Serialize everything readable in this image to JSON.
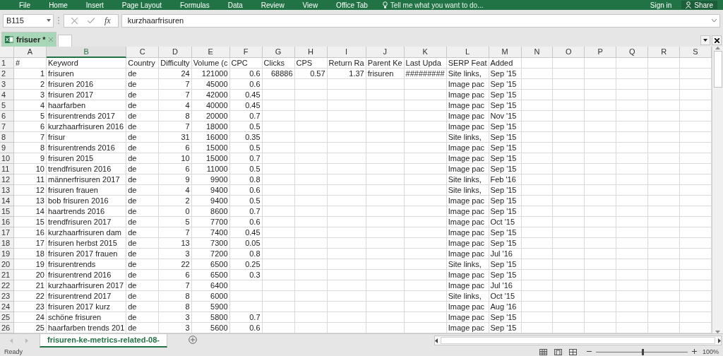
{
  "ribbon": {
    "tabs": [
      "File",
      "Home",
      "Insert",
      "Page Layout",
      "Formulas",
      "Data",
      "Review",
      "View",
      "Office Tab"
    ],
    "tell_me": "Tell me what you want to do...",
    "sign_in": "Sign in",
    "share": "Share"
  },
  "formula_bar": {
    "name_box": "B115",
    "function_label": "fx",
    "value": "kurzhaarfrisuren"
  },
  "document_tabs": [
    {
      "label": "frisuer *",
      "selected": true
    }
  ],
  "sheet": {
    "columns": [
      {
        "label": "A",
        "selected": false
      },
      {
        "label": "B",
        "selected": true
      },
      {
        "label": "C",
        "selected": false
      },
      {
        "label": "D",
        "selected": false
      },
      {
        "label": "E",
        "selected": false
      },
      {
        "label": "F",
        "selected": false
      },
      {
        "label": "G",
        "selected": false
      },
      {
        "label": "H",
        "selected": false
      },
      {
        "label": "I",
        "selected": false
      },
      {
        "label": "J",
        "selected": false
      },
      {
        "label": "K",
        "selected": false
      },
      {
        "label": "L",
        "selected": false
      },
      {
        "label": "M",
        "selected": false
      },
      {
        "label": "N",
        "selected": false
      },
      {
        "label": "O",
        "selected": false
      },
      {
        "label": "P",
        "selected": false
      },
      {
        "label": "Q",
        "selected": false
      },
      {
        "label": "R",
        "selected": false
      },
      {
        "label": "S",
        "selected": false
      }
    ],
    "rows": [
      {
        "number": "1",
        "cells": [
          "#",
          "Keyword",
          "Country",
          "Difficulty",
          "Volume (c",
          "CPC",
          "Clicks",
          "CPS",
          "Return Ra",
          "Parent Ke",
          "Last Upda",
          "SERP Feat",
          "Added"
        ]
      },
      {
        "number": "2",
        "cells": [
          "1",
          "frisuren",
          "de",
          "24",
          "121000",
          "0.6",
          "68886",
          "0.57",
          "1.37",
          "frisuren",
          "#########",
          "Site links,",
          "Sep '15"
        ]
      },
      {
        "number": "3",
        "cells": [
          "2",
          "frisuren 2016",
          "de",
          "7",
          "45000",
          "0.6",
          null,
          null,
          null,
          null,
          null,
          "Image pac",
          "Sep '15"
        ]
      },
      {
        "number": "4",
        "cells": [
          "3",
          "frisuren 2017",
          "de",
          "7",
          "42000",
          "0.45",
          null,
          null,
          null,
          null,
          null,
          "Image pac",
          "Sep '15"
        ]
      },
      {
        "number": "5",
        "cells": [
          "4",
          "haarfarben",
          "de",
          "4",
          "40000",
          "0.45",
          null,
          null,
          null,
          null,
          null,
          "Image pac",
          "Sep '15"
        ]
      },
      {
        "number": "6",
        "cells": [
          "5",
          "frisurentrends 2017",
          "de",
          "8",
          "20000",
          "0.7",
          null,
          null,
          null,
          null,
          null,
          "Image pac",
          "Nov '15"
        ]
      },
      {
        "number": "7",
        "cells": [
          "6",
          "kurzhaarfrisuren 2016",
          "de",
          "7",
          "18000",
          "0.5",
          null,
          null,
          null,
          null,
          null,
          "Image pac",
          "Sep '15"
        ]
      },
      {
        "number": "8",
        "cells": [
          "7",
          "frisur",
          "de",
          "31",
          "16000",
          "0.35",
          null,
          null,
          null,
          null,
          null,
          "Site links,",
          "Sep '15"
        ]
      },
      {
        "number": "9",
        "cells": [
          "8",
          "frisurentrends 2016",
          "de",
          "6",
          "15000",
          "0.5",
          null,
          null,
          null,
          null,
          null,
          "Image pac",
          "Sep '15"
        ]
      },
      {
        "number": "10",
        "cells": [
          "9",
          "frisuren 2015",
          "de",
          "10",
          "15000",
          "0.7",
          null,
          null,
          null,
          null,
          null,
          "Image pac",
          "Sep '15"
        ]
      },
      {
        "number": "11",
        "cells": [
          "10",
          "trendfrisuren 2016",
          "de",
          "6",
          "11000",
          "0.5",
          null,
          null,
          null,
          null,
          null,
          "Image pac",
          "Sep '15"
        ]
      },
      {
        "number": "12",
        "cells": [
          "11",
          "männerfrisuren 2017",
          "de",
          "9",
          "9900",
          "0.8",
          null,
          null,
          null,
          null,
          null,
          "Site links,",
          "Feb '16"
        ]
      },
      {
        "number": "13",
        "cells": [
          "12",
          "frisuren frauen",
          "de",
          "4",
          "9400",
          "0.6",
          null,
          null,
          null,
          null,
          null,
          "Site links,",
          "Sep '15"
        ]
      },
      {
        "number": "14",
        "cells": [
          "13",
          "bob frisuren 2016",
          "de",
          "2",
          "9400",
          "0.5",
          null,
          null,
          null,
          null,
          null,
          "Image pac",
          "Sep '15"
        ]
      },
      {
        "number": "15",
        "cells": [
          "14",
          "haartrends 2016",
          "de",
          "0",
          "8600",
          "0.7",
          null,
          null,
          null,
          null,
          null,
          "Image pac",
          "Sep '15"
        ]
      },
      {
        "number": "16",
        "cells": [
          "15",
          "trendfrisuren 2017",
          "de",
          "5",
          "7700",
          "0.6",
          null,
          null,
          null,
          null,
          null,
          "Image pac",
          "Oct '15"
        ]
      },
      {
        "number": "17",
        "cells": [
          "16",
          "kurzhaarfrisuren dam",
          "de",
          "7",
          "7400",
          "0.45",
          null,
          null,
          null,
          null,
          null,
          "Image pac",
          "Sep '15"
        ]
      },
      {
        "number": "18",
        "cells": [
          "17",
          "frisuren herbst 2015",
          "de",
          "13",
          "7300",
          "0.05",
          null,
          null,
          null,
          null,
          null,
          "Image pac",
          "Sep '15"
        ]
      },
      {
        "number": "19",
        "cells": [
          "18",
          "frisuren 2017 frauen",
          "de",
          "3",
          "7200",
          "0.8",
          null,
          null,
          null,
          null,
          null,
          "Image pac",
          "Jul '16"
        ]
      },
      {
        "number": "20",
        "cells": [
          "19",
          "frisurentrends",
          "de",
          "22",
          "6500",
          "0.25",
          null,
          null,
          null,
          null,
          null,
          "Site links,",
          "Sep '15"
        ]
      },
      {
        "number": "21",
        "cells": [
          "20",
          "frisurentrend 2016",
          "de",
          "6",
          "6500",
          "0.3",
          null,
          null,
          null,
          null,
          null,
          "Image pac",
          "Sep '15"
        ]
      },
      {
        "number": "22",
        "cells": [
          "21",
          "kurzhaarfrisuren 2017",
          "de",
          "7",
          "6400",
          null,
          null,
          null,
          null,
          null,
          null,
          "Image pac",
          "Jul '16"
        ]
      },
      {
        "number": "23",
        "cells": [
          "22",
          "frisurentrend 2017",
          "de",
          "8",
          "6000",
          null,
          null,
          null,
          null,
          null,
          null,
          "Site links,",
          "Oct '15"
        ]
      },
      {
        "number": "24",
        "cells": [
          "23",
          "frisuren 2017 kurz",
          "de",
          "8",
          "5900",
          null,
          null,
          null,
          null,
          null,
          null,
          "Image pac",
          "Aug '16"
        ]
      },
      {
        "number": "25",
        "cells": [
          "24",
          "schöne frisuren",
          "de",
          "3",
          "5800",
          "0.7",
          null,
          null,
          null,
          null,
          null,
          "Image pac",
          "Sep '15"
        ]
      },
      {
        "number": "26",
        "cells": [
          "25",
          "haarfarben trends 201",
          "de",
          "3",
          "5600",
          "0.6",
          null,
          null,
          null,
          null,
          null,
          "Image pac",
          "Sep '15"
        ]
      }
    ]
  },
  "sheet_tabs": [
    {
      "label": "frisuren-ke-metrics-related-08-",
      "selected": true
    }
  ],
  "status_bar": {
    "status": "Ready",
    "zoom": {
      "level": 0.5,
      "label": "100%"
    }
  }
}
